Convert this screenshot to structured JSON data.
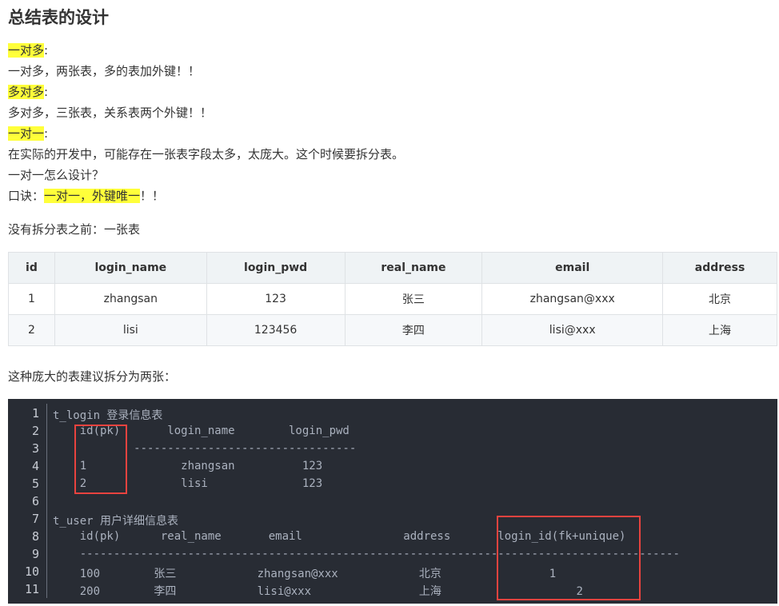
{
  "heading": "总结表的设计",
  "sections": {
    "one_to_many_label": "一对多",
    "one_to_many_text": "一对多，两张表，多的表加外键！！",
    "many_to_many_label": "多对多",
    "many_to_many_text": "多对多，三张表，关系表两个外键！！",
    "one_to_one_label": "一对一",
    "one_to_one_text": "在实际的开发中，可能存在一张表字段太多，太庞大。这个时候要拆分表。",
    "question": "一对一怎么设计？",
    "formula_label": "口诀：",
    "formula_highlight": "一对一，外键唯一",
    "formula_tail": "！！",
    "colon": ":",
    "before_split": "没有拆分表之前：一张表",
    "suggestion": "这种庞大的表建议拆分为两张："
  },
  "table": {
    "headers": [
      "id",
      "login_name",
      "login_pwd",
      "real_name",
      "email",
      "address"
    ],
    "rows": [
      [
        "1",
        "zhangsan",
        "123",
        "张三",
        "zhangsan@xxx",
        "北京"
      ],
      [
        "2",
        "lisi",
        "123456",
        "李四",
        "lisi@xxx",
        "上海"
      ]
    ]
  },
  "code": {
    "line_numbers": [
      "1",
      "2",
      "3",
      "4",
      "5",
      "6",
      "7",
      "8",
      "9",
      "10",
      "11"
    ],
    "lines": [
      "t_login 登录信息表",
      "    id(pk)       login_name        login_pwd",
      "            ---------------------------------",
      "    1              zhangsan          123",
      "    2              lisi              123",
      "",
      "t_user 用户详细信息表",
      "    id(pk)      real_name       email               address       login_id(fk+unique)",
      "    -----------------------------------------------------------------------------------------",
      "    100        张三            zhangsan@xxx            北京                1",
      "    200        李四            lisi@xxx                上海                    2"
    ]
  },
  "colors": {
    "highlight": "#ffff3a",
    "code_background": "#282c34",
    "annotation_box": "#e8433f"
  }
}
